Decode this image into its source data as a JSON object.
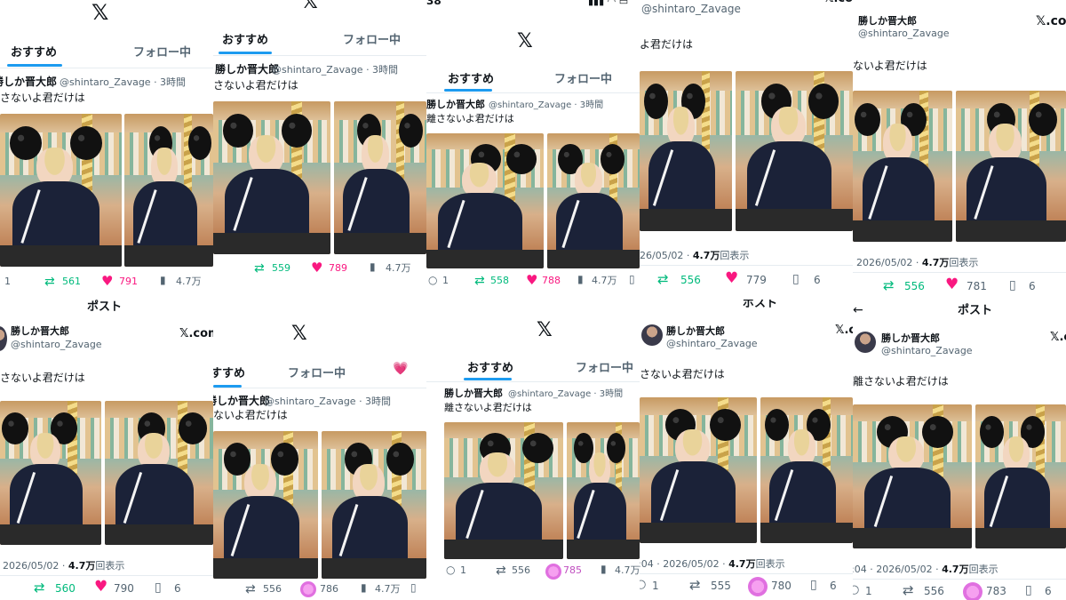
{
  "post": {
    "author_name": "勝しか晋大郎",
    "author_handle": "@shintaro_Zavage",
    "time_ago": "3時間",
    "text": "離さないよ君だけは",
    "date": "2026/05/02",
    "views": "4.7万",
    "views_suffix": "回表示",
    "time_prefix": ":04"
  },
  "tabs": {
    "recommended": "おすすめ",
    "following": "フォロー中"
  },
  "post_header": "ポスト",
  "x_logo": "𝕏",
  "x_com": "𝕏.com",
  "status_time": "38",
  "tiles": [
    {
      "name_line": "勝しか晋大郎",
      "handle_line": "@shintaro_Zavage · 3時間",
      "text": "さないよ君だけは",
      "replies": "1",
      "retweets": "561",
      "likes": "791",
      "views": "4.7万"
    },
    {
      "name_line": "勝しか晋大郎",
      "handle_line": "@shintaro_Zavage · 3時間",
      "text": "さないよ君だけは",
      "retweets": "559",
      "likes": "789",
      "views": "4.7万"
    },
    {
      "name_line": "勝しか晋大郎",
      "handle_line": "@shintaro_Zavage · 3時間",
      "text": "離さないよ君だけは",
      "replies": "1",
      "retweets": "558",
      "likes": "788",
      "views": "4.7万"
    },
    {
      "text": "よ君だけは",
      "date_line": "26/05/02 · ",
      "views": "4.7万",
      "views_suffix": "回表示",
      "retweets": "556",
      "likes": "779",
      "bookmarks": "6"
    },
    {
      "name": "勝しか晋大郎",
      "handle": "@shintaro_Zavage",
      "text": "ないよ君だけは",
      "date_line": "2026/05/02 · ",
      "views": "4.7万",
      "views_suffix": "回表示",
      "retweets": "556",
      "likes": "781",
      "bookmarks": "6"
    },
    {
      "name": "勝しか晋大郎",
      "handle": "@shintaro_Zavage",
      "text": "さないよ君だけは",
      "date_line": "· 2026/05/02 · ",
      "views": "4.7万",
      "views_suffix": "回表示",
      "retweets": "560",
      "likes": "790",
      "bookmarks": "6"
    },
    {
      "name_line": "勝しか晋大郎",
      "handle_line": "@shintaro_Zavage · 3時間",
      "text": "ないよ君だけは",
      "retweets": "556",
      "likes": "786",
      "views": "4.7万"
    },
    {
      "name_line": "勝しか晋大郎",
      "handle_line": "@shintaro_Zavage · 3時間",
      "text": "離さないよ君だけは",
      "replies": "1",
      "retweets": "556",
      "likes": "785",
      "views": "4.7万"
    },
    {
      "name": "勝しか晋大郎",
      "handle": "@shintaro_Zavage",
      "text": "さないよ君だけは",
      "date_line": ":04 · 2026/05/02 · ",
      "views": "4.7万",
      "views_suffix": "回表示",
      "replies": "1",
      "retweets": "555",
      "likes": "780",
      "bookmarks": "6"
    },
    {
      "name": "勝しか晋大郎",
      "handle": "@shintaro_Zavage",
      "text": "離さないよ君だけは",
      "date_line": ":04 · 2026/05/02 · ",
      "views": "4.7万",
      "views_suffix": "回表示",
      "replies": "1",
      "retweets": "556",
      "likes": "783",
      "bookmarks": "6"
    }
  ],
  "icons": {
    "reply": "reply-icon",
    "retweet": "retweet-icon",
    "like": "heart-icon",
    "views": "views-bar-chart-icon",
    "bookmark": "bookmark-icon",
    "x": "x-logo-icon"
  },
  "colors": {
    "accent": "#1d9bf0",
    "retweet": "#00ba7c",
    "like": "#f91880",
    "text": "#0f1419",
    "muted": "#536471"
  }
}
